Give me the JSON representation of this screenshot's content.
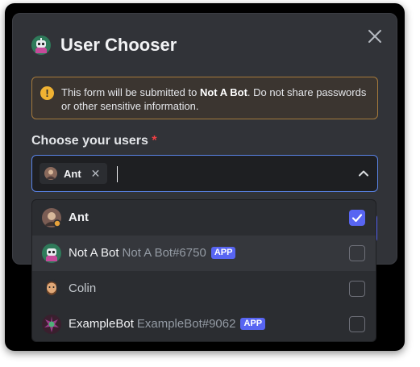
{
  "modal": {
    "title": "User Chooser",
    "bot_icon": "robot-avatar-icon",
    "close_icon": "close-icon",
    "warning": {
      "icon": "exclamation-icon",
      "prefix": "This form will be submitted to ",
      "bot_name": "Not A Bot",
      "suffix": ". Do not share passwords or other sensitive information."
    },
    "field_label": "Choose your users",
    "required_mark": "*",
    "selected_chip": {
      "label": "Ant",
      "remove": "✕"
    },
    "options": [
      {
        "name": "Ant",
        "sub": "",
        "badge": "",
        "checked": true
      },
      {
        "name": "Not A Bot",
        "sub": "Not A Bot#6750",
        "badge": "APP",
        "checked": false
      },
      {
        "name": "Colin",
        "sub": "",
        "badge": "",
        "checked": false
      },
      {
        "name": "ExampleBot",
        "sub": "ExampleBot#9062",
        "badge": "APP",
        "checked": false
      }
    ]
  },
  "colors": {
    "background": "#313338",
    "accent": "#5865f2",
    "warning": "#f0b232",
    "required": "#f23f43"
  }
}
